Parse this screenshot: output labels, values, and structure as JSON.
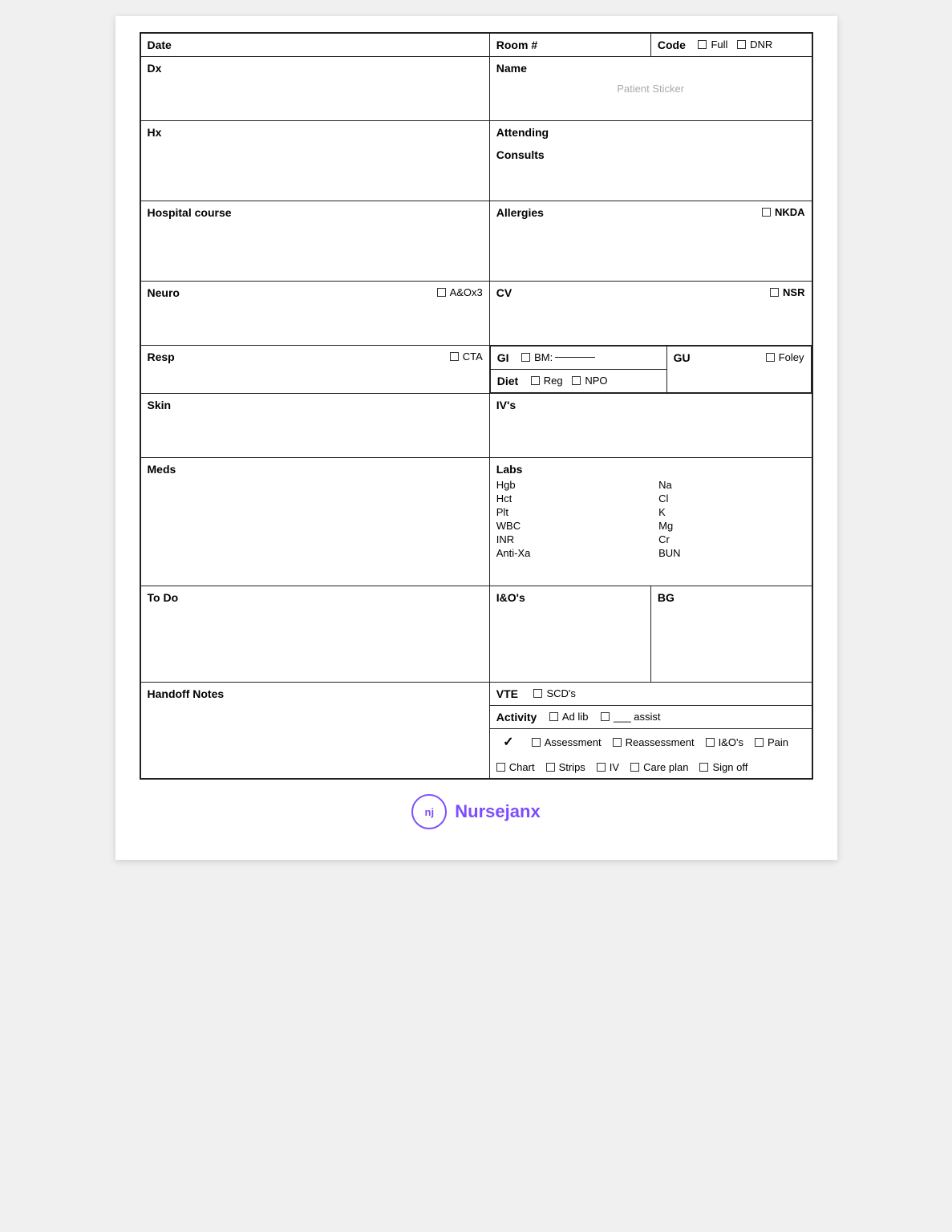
{
  "form": {
    "date_label": "Date",
    "room_label": "Room #",
    "code_label": "Code",
    "full_label": "Full",
    "dnr_label": "DNR",
    "dx_label": "Dx",
    "name_label": "Name",
    "patient_sticker": "Patient Sticker",
    "hx_label": "Hx",
    "attending_label": "Attending",
    "consults_label": "Consults",
    "hospital_course_label": "Hospital course",
    "allergies_label": "Allergies",
    "nkda_label": "NKDA",
    "neuro_label": "Neuro",
    "aox3_label": "A&Ox3",
    "cv_label": "CV",
    "nsr_label": "NSR",
    "resp_label": "Resp",
    "cta_label": "CTA",
    "gi_label": "GI",
    "bm_label": "BM:",
    "gu_label": "GU",
    "foley_label": "Foley",
    "diet_label": "Diet",
    "reg_label": "Reg",
    "npo_label": "NPO",
    "skin_label": "Skin",
    "ivs_label": "IV's",
    "meds_label": "Meds",
    "labs_label": "Labs",
    "labs_left": [
      "Hgb",
      "Hct",
      "Plt",
      "WBC",
      "INR",
      "Anti-Xa"
    ],
    "labs_right": [
      "Na",
      "Cl",
      "K",
      "Mg",
      "Cr",
      "BUN"
    ],
    "todo_label": "To Do",
    "io_label": "I&O's",
    "bg_label": "BG",
    "handoff_label": "Handoff Notes",
    "vte_label": "VTE",
    "scds_label": "SCD's",
    "activity_label": "Activity",
    "ad_lib_label": "Ad lib",
    "assist_label": "___ assist",
    "footer": {
      "checkmark": "✓",
      "assessment": "Assessment",
      "reassessment": "Reassessment",
      "iandos": "I&O's",
      "pain": "Pain",
      "chart": "Chart",
      "strips": "Strips",
      "iv": "IV",
      "care_plan": "Care plan",
      "sign_off": "Sign off"
    }
  },
  "logo": {
    "initials": "nj",
    "brand_text": "janx",
    "brand_prefix": "Nurse"
  }
}
